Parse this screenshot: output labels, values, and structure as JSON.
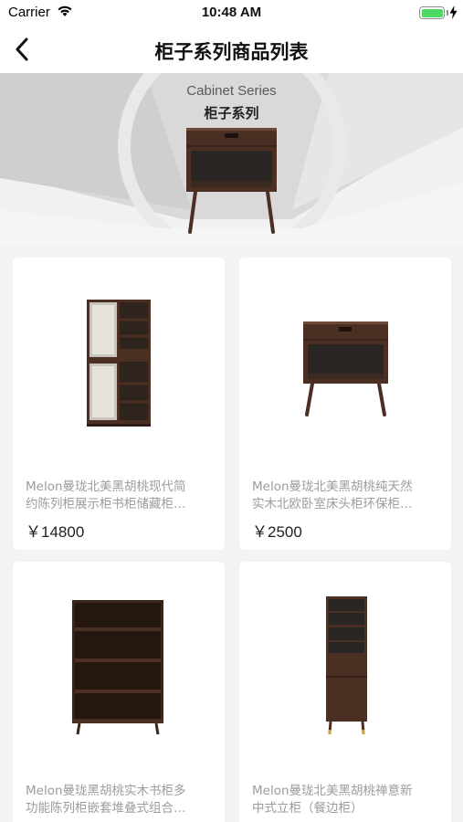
{
  "status_bar": {
    "carrier": "Carrier",
    "time": "10:48 AM",
    "battery_level": 1.0
  },
  "nav": {
    "title": "柜子系列商品列表"
  },
  "banner": {
    "title_en": "Cabinet Series",
    "title_cn": "柜子系列"
  },
  "products": [
    {
      "name_line1": "Melon曼珑北美黑胡桃现代简",
      "name_line2": "约陈列柜展示柜书柜储藏柜…",
      "price": "￥14800",
      "image": "glass-display-cabinet"
    },
    {
      "name_line1": "Melon曼珑北美黑胡桃纯天然",
      "name_line2": "实木北欧卧室床头柜环保柜…",
      "price": "￥2500",
      "image": "nightstand"
    },
    {
      "name_line1": "Melon曼珑黑胡桃实木书柜多",
      "name_line2": "功能陈列柜嵌套堆叠式组合…",
      "price": "",
      "image": "bookcase"
    },
    {
      "name_line1": "Melon曼珑北美黑胡桃禅意新",
      "name_line2": "中式立柜（餐边柜）",
      "price": "",
      "image": "tall-cabinet"
    }
  ],
  "colors": {
    "walnut": "#4a2f22",
    "walnut_dark": "#2e1d15",
    "background": "#f3f3f3"
  }
}
